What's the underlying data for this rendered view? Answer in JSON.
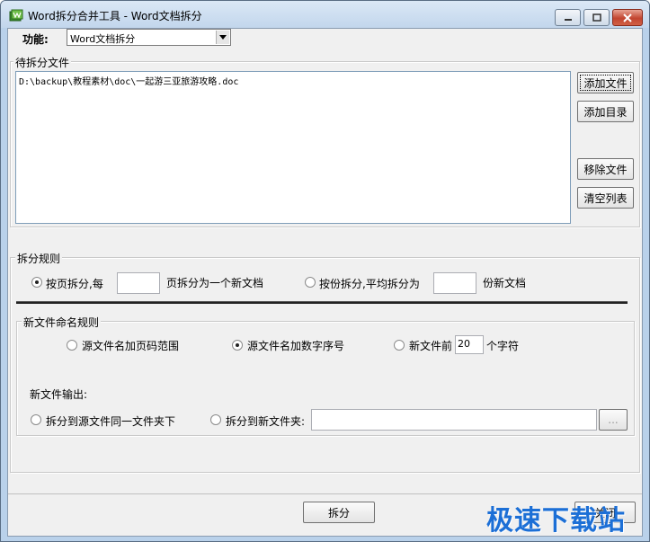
{
  "window": {
    "title": "Word拆分合并工具 - Word文档拆分"
  },
  "function_row": {
    "label": "功能:",
    "selected": "Word文档拆分"
  },
  "files_group": {
    "title": "待拆分文件",
    "items": [
      "D:\\backup\\教程素材\\doc\\一起游三亚旅游攻略.doc"
    ],
    "buttons": {
      "add_file": "添加文件",
      "add_dir": "添加目录",
      "remove_file": "移除文件",
      "clear_list": "清空列表"
    }
  },
  "rules_group": {
    "title": "拆分规则",
    "by_page": {
      "prefix": "按页拆分,每",
      "value": "",
      "suffix": "页拆分为一个新文档",
      "checked": true
    },
    "by_count": {
      "prefix": "按份拆分,平均拆分为",
      "value": "",
      "suffix": "份新文档",
      "checked": false
    }
  },
  "naming_group": {
    "title": "新文件命名规则",
    "opt_page_range": "源文件名加页码范围",
    "opt_number": "源文件名加数字序号",
    "opt_prefix": {
      "label": "新文件前",
      "value": "20",
      "suffix": "个字符"
    },
    "output_label": "新文件输出:",
    "out_same": "拆分到源文件同一文件夹下",
    "out_new": "拆分到新文件夹:",
    "out_path": "",
    "browse": "..."
  },
  "actions": {
    "split": "拆分",
    "close": "关闭"
  },
  "watermark": "极速下载站"
}
